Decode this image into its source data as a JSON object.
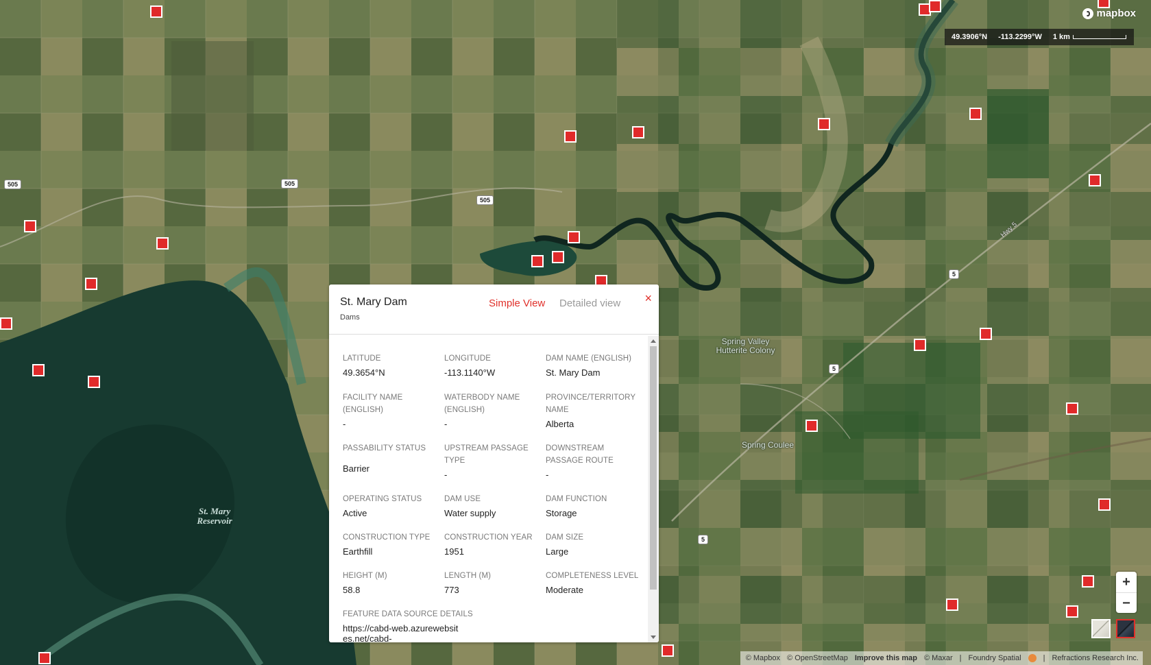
{
  "map": {
    "brand": "mapbox",
    "coord_readout": {
      "lat": "49.3906°N",
      "lon": "-113.2299°W"
    },
    "scale_label": "1 km",
    "road_shields": [
      "505",
      "505",
      "505",
      "5",
      "5",
      "5"
    ],
    "road_label": "Hwy 5",
    "place_labels": [
      "Spring Valley Hutterite Colony",
      "Spring Coulee"
    ],
    "lake_label": "St. Mary Reservoir",
    "marker_count": 29,
    "marker_color": "#e02a2a",
    "zoom_in": "+",
    "zoom_out": "−",
    "basemaps": [
      "light",
      "dark"
    ],
    "attribution": [
      "© Mapbox",
      "© OpenStreetMap",
      "Improve this map",
      "© Maxar",
      "Foundry Spatial",
      "Refractions Research Inc."
    ]
  },
  "popup": {
    "title": "St. Mary Dam",
    "subtitle": "Dams",
    "tab_simple": "Simple View",
    "tab_detailed": "Detailed view",
    "close": "×",
    "accent_color": "#e0302a",
    "fields": [
      {
        "label": "LATITUDE",
        "value": "49.3654°N"
      },
      {
        "label": "LONGITUDE",
        "value": "-113.1140°W"
      },
      {
        "label": "DAM NAME (ENGLISH)",
        "value": "St. Mary Dam"
      },
      {
        "label": "FACILITY NAME (ENGLISH)",
        "value": "-"
      },
      {
        "label": "WATERBODY NAME (ENGLISH)",
        "value": "-"
      },
      {
        "label": "PROVINCE/TERRITORY NAME",
        "value": "Alberta"
      },
      {
        "label": "PASSABILITY STATUS",
        "value": "Barrier"
      },
      {
        "label": "UPSTREAM PASSAGE TYPE",
        "value": "-"
      },
      {
        "label": "DOWNSTREAM PASSAGE ROUTE",
        "value": "-"
      },
      {
        "label": "OPERATING STATUS",
        "value": "Active"
      },
      {
        "label": "DAM USE",
        "value": "Water supply"
      },
      {
        "label": "DAM FUNCTION",
        "value": "Storage"
      },
      {
        "label": "CONSTRUCTION TYPE",
        "value": "Earthfill"
      },
      {
        "label": "CONSTRUCTION YEAR",
        "value": "1951"
      },
      {
        "label": "DAM SIZE",
        "value": "Large"
      },
      {
        "label": "HEIGHT (M)",
        "value": "58.8"
      },
      {
        "label": "LENGTH (M)",
        "value": "773"
      },
      {
        "label": "COMPLETENESS LEVEL",
        "value": "Moderate"
      },
      {
        "label": "FEATURE DATA SOURCE DETAILS",
        "value": "https://cabd-web.azurewebsites.net/cabd-"
      }
    ]
  }
}
